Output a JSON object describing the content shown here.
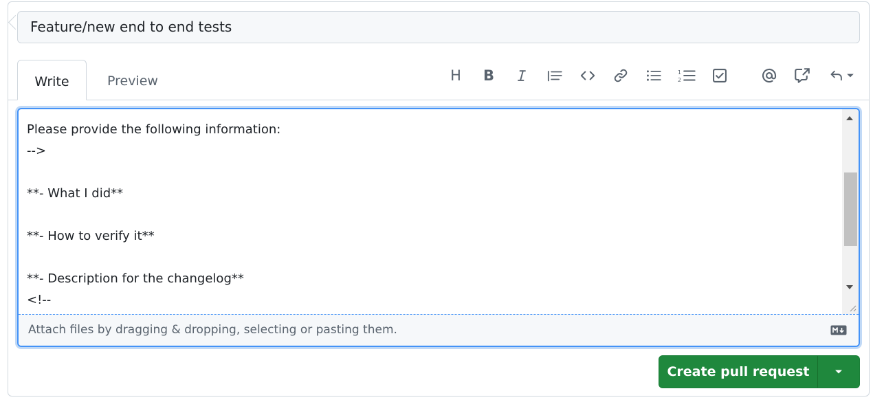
{
  "pr": {
    "title_value": "Feature/new end to end tests"
  },
  "tabs": {
    "write_label": "Write",
    "preview_label": "Preview"
  },
  "toolbar": {
    "heading_label": "H",
    "bold_label": "B",
    "icons": [
      "heading-icon",
      "bold-icon",
      "italic-icon",
      "quote-icon",
      "code-icon",
      "link-icon",
      "bulleted-list-icon",
      "numbered-list-icon",
      "task-list-icon",
      "mention-icon",
      "cross-reference-icon",
      "undo-icon",
      "chevron-down-icon"
    ]
  },
  "editor": {
    "body": "Please provide the following information:\n-->\n\n**- What I did**\n\n**- How to verify it**\n\n**- Description for the changelog**\n<!--",
    "attach_hint": "Attach files by dragging & dropping, selecting or pasting them."
  },
  "actions": {
    "create_label": "Create pull request"
  },
  "colors": {
    "accent_green": "#1f883d",
    "focus_blue": "#4493f8",
    "border": "#d0d7de",
    "muted_text": "#59636e"
  }
}
